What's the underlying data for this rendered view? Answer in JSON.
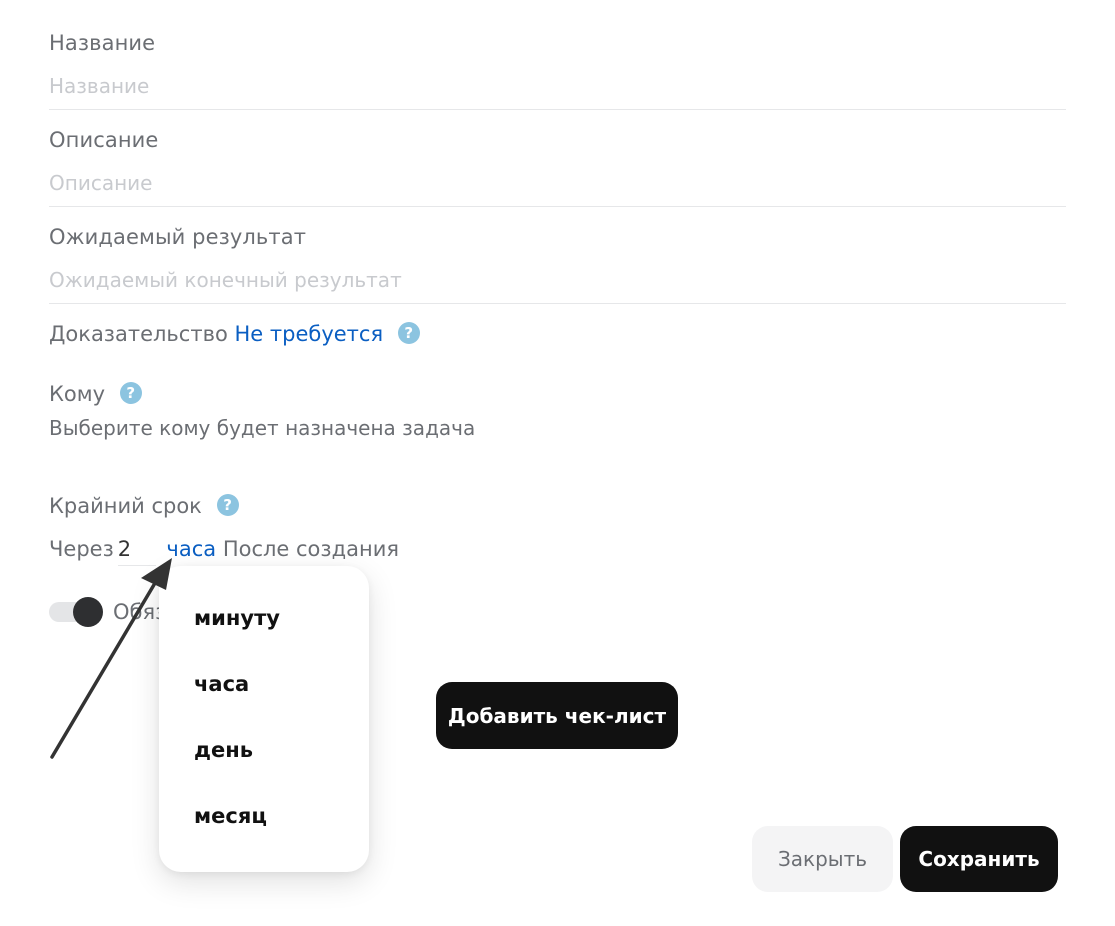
{
  "fields": {
    "name": {
      "label": "Название",
      "placeholder": "Название",
      "value": ""
    },
    "description": {
      "label": "Описание",
      "placeholder": "Описание",
      "value": ""
    },
    "expected": {
      "label": "Ожидаемый результат",
      "placeholder": "Ожидаемый конечный результат",
      "value": ""
    }
  },
  "proof": {
    "label": "Доказательство",
    "value": "Не требуется",
    "help_icon": "question-circle-icon"
  },
  "assignee": {
    "label": "Кому",
    "link": "Выберите кому будет назначена задача",
    "help_icon": "question-circle-icon"
  },
  "deadline": {
    "label": "Крайний срок",
    "prefix": "Через",
    "amount": "2",
    "unit": "часа",
    "suffix": "После создания",
    "help_icon": "question-circle-icon"
  },
  "toggle": {
    "label_visible": "Обяз",
    "on": true
  },
  "dropdown": {
    "items": [
      "минуту",
      "часа",
      "день",
      "месяц"
    ]
  },
  "buttons": {
    "add_checklist": "Добавить чек-лист",
    "close": "Закрыть",
    "save": "Сохранить"
  },
  "colors": {
    "link": "#0a5ec2",
    "help": "#8cc4e0",
    "primary": "#111111"
  }
}
